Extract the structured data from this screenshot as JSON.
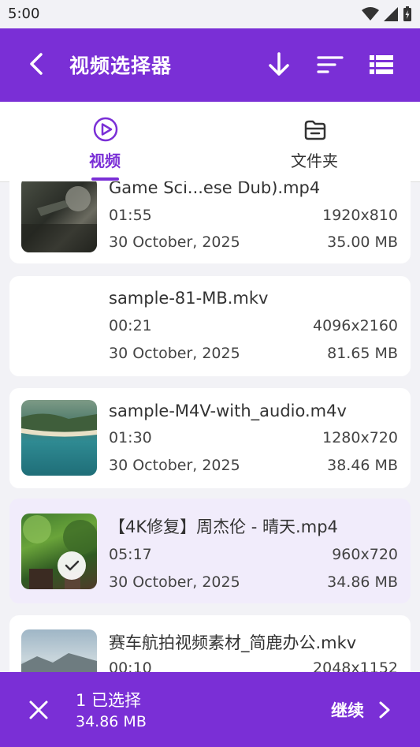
{
  "status": {
    "time": "5:00"
  },
  "appbar": {
    "title": "视频选择器",
    "icons": [
      "arrow-back-icon",
      "download-icon",
      "sort-icon",
      "list-view-icon"
    ]
  },
  "tabs": [
    {
      "label": "视频",
      "icon": "play-circle-icon",
      "active": true
    },
    {
      "label": "文件夹",
      "icon": "folder-icon",
      "active": false
    }
  ],
  "videos": [
    {
      "name": "Game Sci...ese Dub).mp4",
      "duration": "01:55",
      "resolution": "1920x810",
      "date": "30 October, 2025",
      "size": "35.00 MB",
      "selected": false
    },
    {
      "name": "sample-81-MB.mkv",
      "duration": "00:21",
      "resolution": "4096x2160",
      "date": "30 October, 2025",
      "size": "81.65 MB",
      "selected": false
    },
    {
      "name": "sample-M4V-with_audio.m4v",
      "duration": "01:30",
      "resolution": "1280x720",
      "date": "30 October, 2025",
      "size": "38.46 MB",
      "selected": false
    },
    {
      "name": "【4K修复】周杰伦 - 晴天.mp4",
      "duration": "05:17",
      "resolution": "960x720",
      "date": "30 October, 2025",
      "size": "34.86 MB",
      "selected": true
    },
    {
      "name": "赛车航拍视频素材_简鹿办公.mkv",
      "duration": "00:10",
      "resolution": "2048x1152",
      "date": "",
      "size": "",
      "selected": false
    }
  ],
  "bottom": {
    "count": "1 已选择",
    "size": "34.86 MB",
    "continue": "继续"
  },
  "colors": {
    "accent": "#7a2fd6",
    "selected_bg": "#f1ecfb",
    "background": "#f2f2f6"
  }
}
